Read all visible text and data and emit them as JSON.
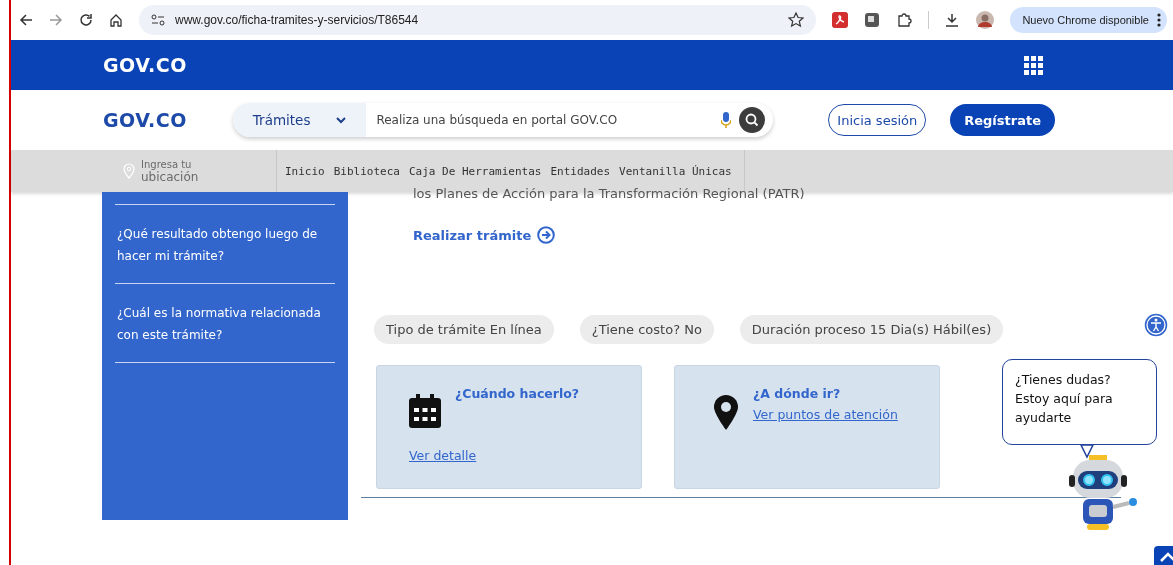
{
  "browser": {
    "url": "www.gov.co/ficha-tramites-y-servicios/T86544",
    "update_button": "Nuevo Chrome disponible"
  },
  "top_bar": {
    "logo": "GOV.CO"
  },
  "header": {
    "logo": "GOV.CO",
    "search_category": "Trámites",
    "search_placeholder": "Realiza una búsqueda en portal GOV.CO",
    "login": "Inicia sesión",
    "register": "Regístrate"
  },
  "nav": {
    "location": [
      "Ingresa tu",
      "ubicación"
    ],
    "items": [
      {
        "label": "Inicio"
      },
      {
        "label": "Biblioteca"
      },
      {
        "label": "Caja De Herramientas"
      },
      {
        "label": "Entidades"
      },
      {
        "label": "Ventanilla Únicas"
      }
    ]
  },
  "sidebar": {
    "items": [
      {
        "label": "¿Qué resultado obtengo luego de hacer mi trámite?"
      },
      {
        "label": "¿Cuál es la normativa relacionada con este trámite?"
      }
    ]
  },
  "content": {
    "intro": "los Planes de Acción para la Transformación Regional (PATR)",
    "action": "Realizar trámite",
    "tags": [
      {
        "label": "Tipo de trámite En línea"
      },
      {
        "label": "¿Tiene costo? No"
      },
      {
        "label": "Duración proceso 15 Dia(s) Hábil(es)"
      }
    ],
    "cards": [
      {
        "kind": "calendar",
        "title": "¿Cuándo hacerlo?",
        "link": "Ver detalle"
      },
      {
        "kind": "pin",
        "title": "¿A dónde ir?",
        "link": "Ver puntos de atención"
      }
    ]
  },
  "chat": {
    "message": "¿Tienes dudas? Estoy aquí para ayudarte"
  }
}
